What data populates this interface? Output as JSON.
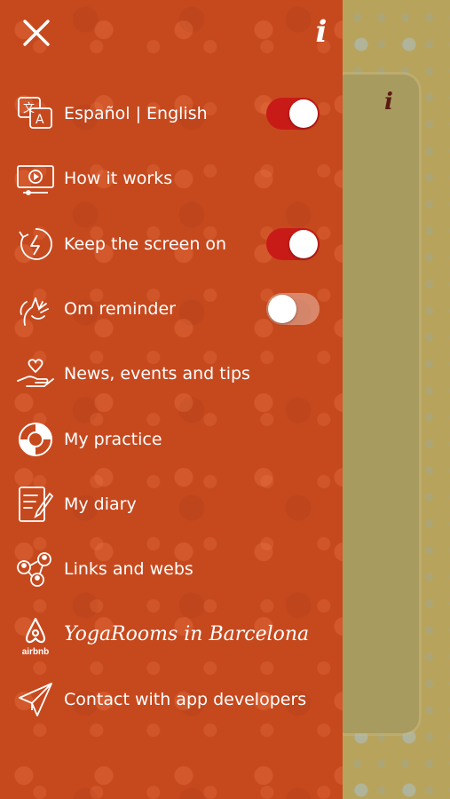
{
  "header": {
    "close_icon": "close-icon",
    "info_label": "i"
  },
  "card": {
    "info_label": "i"
  },
  "menu": {
    "items": [
      {
        "label": "Español | English",
        "icon": "translate-icon",
        "toggle": true,
        "toggle_on": true
      },
      {
        "label": "How it works",
        "icon": "video-icon",
        "toggle": false
      },
      {
        "label": "Keep the screen on",
        "icon": "power-rotate-icon",
        "toggle": true,
        "toggle_on": true
      },
      {
        "label": "Om reminder",
        "icon": "meditation-icon",
        "toggle": true,
        "toggle_on": false
      },
      {
        "label": "News, events and tips",
        "icon": "heart-hand-icon",
        "toggle": false
      },
      {
        "label": "My practice",
        "icon": "donut-chart-icon",
        "toggle": false
      },
      {
        "label": "My diary",
        "icon": "diary-icon",
        "toggle": false
      },
      {
        "label": "Links and webs",
        "icon": "people-network-icon",
        "toggle": false
      },
      {
        "label": "YogaRooms in Barcelona",
        "icon": "airbnb-icon",
        "icon_text": "airbnb",
        "toggle": false
      },
      {
        "label": "Contact with app developers",
        "icon": "paper-plane-icon",
        "toggle": false
      }
    ]
  },
  "colors": {
    "drawer": "#c6491e",
    "toggle_on": "#c81b18",
    "background": "#b7a35c"
  }
}
